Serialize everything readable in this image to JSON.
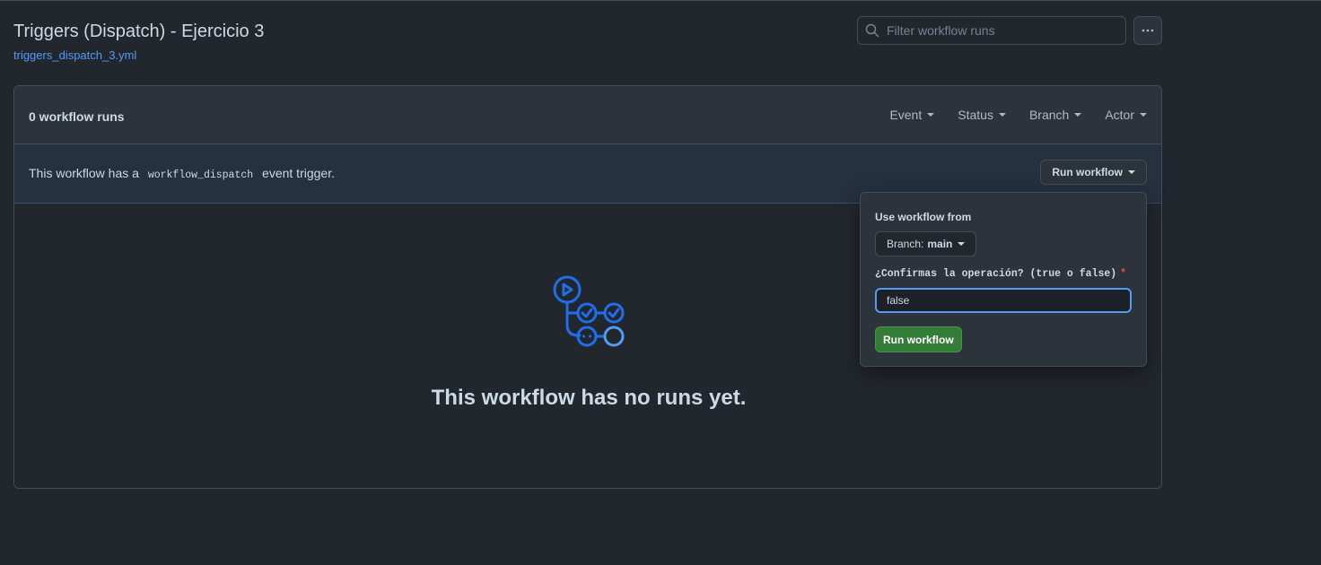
{
  "header": {
    "title": "Triggers (Dispatch) - Ejercicio 3",
    "file_link": "triggers_dispatch_3.yml",
    "search_placeholder": "Filter workflow runs"
  },
  "runs": {
    "count_label": "0 workflow runs",
    "filters": [
      "Event",
      "Status",
      "Branch",
      "Actor"
    ]
  },
  "dispatch": {
    "text_before": "This workflow has a",
    "code": "workflow_dispatch",
    "text_after": "event trigger.",
    "run_button_label": "Run workflow"
  },
  "empty_state": {
    "icon": "workflow-icon",
    "message": "This workflow has no runs yet."
  },
  "run_dropdown": {
    "title": "Use workflow from",
    "branch_prefix": "Branch:",
    "branch_name": "main",
    "input_label": "¿Confirmas la operación? (true o false)",
    "required_mark": "*",
    "input_value": "false",
    "submit_label": "Run workflow"
  },
  "colors": {
    "background": "#22272e",
    "accent": "#539bf5",
    "success": "#347d39",
    "icon_blue": "#1f6feb"
  }
}
